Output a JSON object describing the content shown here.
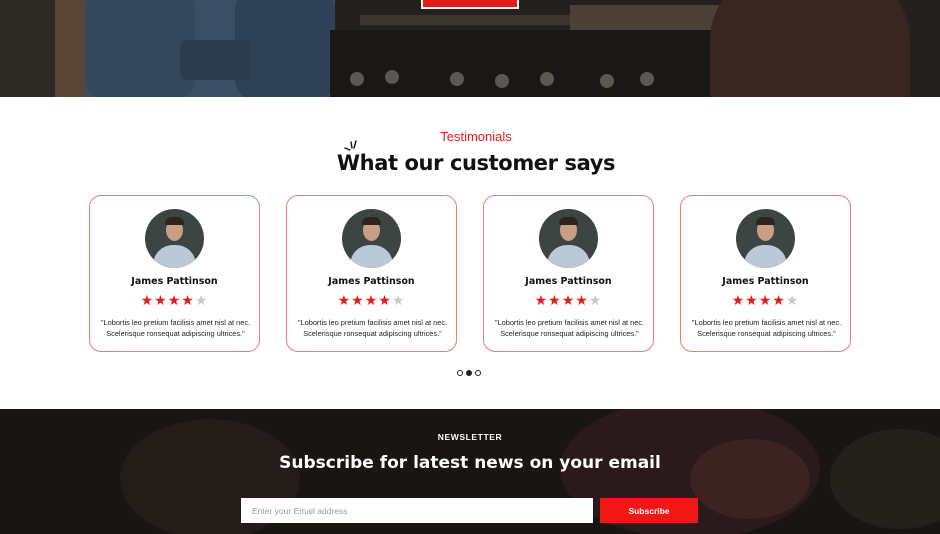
{
  "testimonials": {
    "eyebrow": "Testimonials",
    "heading": "What our customer says",
    "cards": [
      {
        "name": "James Pattinson",
        "rating": 4,
        "rating_max": 5,
        "quote": "\"Lobortis leo pretium facilisis amet nisl at nec. Scelerisque ronsequat adipiscing ultrices.\""
      },
      {
        "name": "James Pattinson",
        "rating": 4,
        "rating_max": 5,
        "quote": "\"Lobortis leo pretium facilisis amet nisl at nec. Scelerisque ronsequat adipiscing ultrices.\""
      },
      {
        "name": "James Pattinson",
        "rating": 4,
        "rating_max": 5,
        "quote": "\"Lobortis leo pretium facilisis amet nisl at nec. Scelerisque ronsequat adipiscing ultrices.\""
      },
      {
        "name": "James Pattinson",
        "rating": 4,
        "rating_max": 5,
        "quote": "\"Lobortis leo pretium facilisis amet nisl at nec. Scelerisque ronsequat adipiscing ultrices.\""
      }
    ],
    "carousel": {
      "pages": 3,
      "active_index": 1
    }
  },
  "newsletter": {
    "eyebrow": "NEWSLETTER",
    "heading": "Subscribe for latest news on your email",
    "email_placeholder": "Enter your Email address",
    "email_value": "",
    "subscribe_label": "Subscribe"
  },
  "colors": {
    "accent": "#e31b1b",
    "card_border": "#f07a7a",
    "star_off": "#c8c8c8",
    "newsletter_bg": "#181512"
  },
  "icons": {
    "star": "star-icon",
    "decor": "sparkle-icon"
  }
}
